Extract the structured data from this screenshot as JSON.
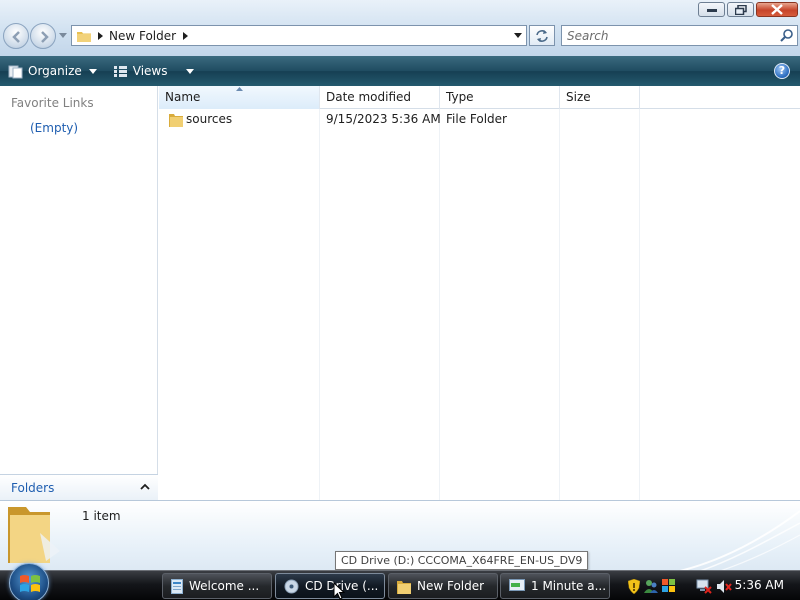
{
  "addressbar": {
    "breadcrumb": [
      "New Folder"
    ],
    "search_placeholder": "Search"
  },
  "toolbar": {
    "organize_label": "Organize",
    "views_label": "Views"
  },
  "navpane": {
    "favorite_links_title": "Favorite Links",
    "favorite_links_empty": "(Empty)",
    "folders_label": "Folders"
  },
  "filelist": {
    "columns": [
      "Name",
      "Date modified",
      "Type",
      "Size"
    ],
    "sorted_column": "Name",
    "rows": [
      {
        "name": "sources",
        "date_modified": "9/15/2023 5:36 AM",
        "type": "File Folder",
        "size": ""
      }
    ]
  },
  "details": {
    "item_count": "1 item"
  },
  "tooltip": {
    "text": "CD Drive (D:) CCCOMA_X64FRE_EN-US_DV9"
  },
  "taskbar": {
    "tasks": [
      {
        "label": "Welcome ...",
        "icon": "document-icon",
        "active": false
      },
      {
        "label": "CD Drive (...",
        "icon": "cd-drive-icon",
        "active": true
      },
      {
        "label": "New Folder",
        "icon": "folder-icon",
        "active": false
      },
      {
        "label": "1 Minute a...",
        "icon": "progress-icon",
        "active": false
      }
    ],
    "clock": "5:36 AM"
  },
  "colors": {
    "toolbar": "#1f4c61",
    "link_blue": "#1f5eb0",
    "folder_yellow": "#e8c052",
    "taskbar": "#14161a"
  }
}
